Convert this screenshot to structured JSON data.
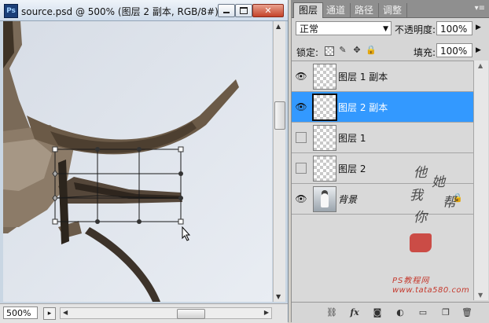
{
  "document": {
    "title": "source.psd @ 500% (图层 2 副本, RGB/8#) *",
    "zoom": "500%",
    "app_icon_text": "Ps"
  },
  "panel": {
    "tabs": [
      "图层",
      "通道",
      "路径",
      "调整"
    ],
    "active_tab": "图层",
    "blend_mode": "正常",
    "opacity_label": "不透明度:",
    "opacity_value": "100%",
    "lock_label": "锁定:",
    "fill_label": "填充:",
    "fill_value": "100%",
    "layers": [
      {
        "name": "图层 1 副本",
        "visible": true,
        "selected": false,
        "type": "transparent"
      },
      {
        "name": "图层 2 副本",
        "visible": true,
        "selected": true,
        "type": "transparent"
      },
      {
        "name": "图层 1",
        "visible": false,
        "selected": false,
        "type": "transparent"
      },
      {
        "name": "图层 2",
        "visible": false,
        "selected": false,
        "type": "transparent"
      },
      {
        "name": "背景",
        "visible": true,
        "selected": false,
        "type": "background",
        "locked": true
      }
    ],
    "watermark": {
      "chars": [
        "他",
        "她",
        "我",
        "帮",
        "你"
      ],
      "site_line1": "PS教程网",
      "site_line2": "www.tata580.com"
    }
  },
  "colors": {
    "selection": "#3399ff",
    "panel_bg": "#d6d6d6"
  }
}
